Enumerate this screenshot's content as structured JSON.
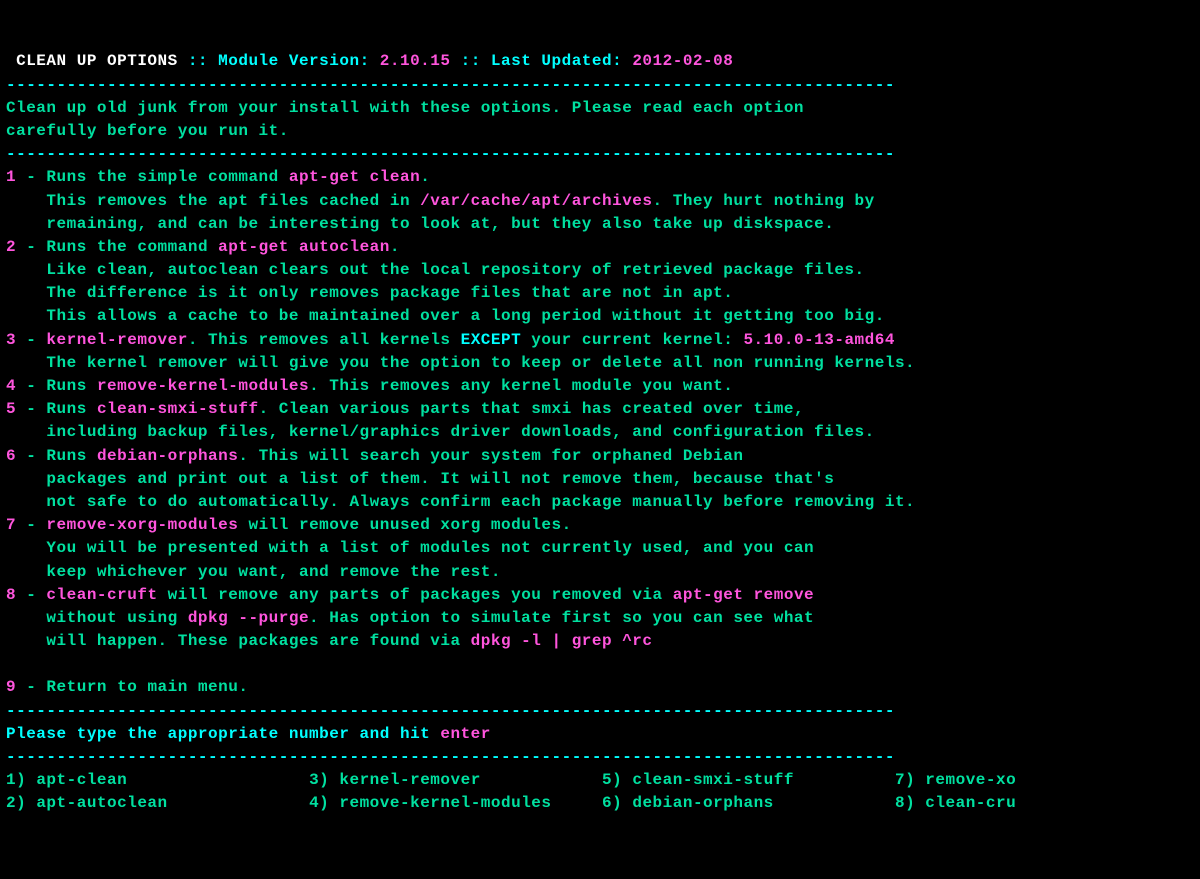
{
  "header": {
    "title": " CLEAN UP OPTIONS ",
    "sep": ":: ",
    "modlabel": "Module Version: ",
    "modver": "2.10.15",
    "sep2": " :: ",
    "updlabel": "Last Updated: ",
    "upddate": "2012-02-08"
  },
  "divider": "----------------------------------------------------------------------------------------",
  "intro1": "Clean up old junk from your install with these options. Please read each option",
  "intro2": "carefully before you run it.",
  "opt1": {
    "num": "1",
    "dash": " - ",
    "a": "Runs the simple command ",
    "cmd": "apt-get clean",
    "b": ".",
    "l2a": "    This removes the apt files cached in ",
    "l2cmd": "/var/cache/apt/archives",
    "l2b": ". They hurt nothing by",
    "l3": "    remaining, and can be interesting to look at, but they also take up diskspace."
  },
  "opt2": {
    "num": "2",
    "dash": " - ",
    "a": "Runs the command ",
    "cmd": "apt-get autoclean",
    "b": ".",
    "l2": "    Like clean, autoclean clears out the local repository of retrieved package files.",
    "l3": "    The difference is it only removes package files that are not in apt.",
    "l4": "    This allows a cache to be maintained over a long period without it getting too big."
  },
  "opt3": {
    "num": "3",
    "dash": " - ",
    "cmd": "kernel-remover",
    "a": ". This removes all kernels ",
    "exc": "EXCEPT",
    "b": " your current kernel: ",
    "kv": "5.10.0-13-amd64",
    "l2": "    The kernel remover will give you the option to keep or delete all non running kernels."
  },
  "opt4": {
    "num": "4",
    "dash": " - ",
    "a": "Runs ",
    "cmd": "remove-kernel-modules",
    "b": ". This removes any kernel module you want."
  },
  "opt5": {
    "num": "5",
    "dash": " - ",
    "a": "Runs ",
    "cmd": "clean-smxi-stuff",
    "b": ". Clean various parts that smxi has created over time,",
    "l2": "    including backup files, kernel/graphics driver downloads, and configuration files."
  },
  "opt6": {
    "num": "6",
    "dash": " - ",
    "a": "Runs ",
    "cmd": "debian-orphans",
    "b": ". This will search your system for orphaned Debian",
    "l2": "    packages and print out a list of them. It will not remove them, because that's",
    "l3": "    not safe to do automatically. Always confirm each package manually before removing it."
  },
  "opt7": {
    "num": "7",
    "dash": " - ",
    "cmd": "remove-xorg-modules",
    "a": " will remove unused xorg modules.",
    "l2": "    You will be presented with a list of modules not currently used, and you can",
    "l3": "    keep whichever you want, and remove the rest."
  },
  "opt8": {
    "num": "8",
    "dash": " - ",
    "cmd": "clean-cruft",
    "a": " will remove any parts of packages you removed via ",
    "cmd2": "apt-get remove",
    "l2a": "    without using ",
    "l2cmd": "dpkg --purge",
    "l2b": ". Has option to simulate first so you can see what",
    "l3a": "    will happen. These packages are found via ",
    "l3cmd": "dpkg -l | grep ^rc"
  },
  "opt9": {
    "num": "9",
    "dash": " - ",
    "a": "Return to main menu."
  },
  "prompt": {
    "a": "Please type the appropriate number and hit ",
    "enter": "enter"
  },
  "menu": {
    "r1_1n": "1) ",
    "r1_1t": "apt-clean",
    "r1_3n": "3) ",
    "r1_3t": "kernel-remover",
    "r1_5n": "5) ",
    "r1_5t": "clean-smxi-stuff",
    "r1_7n": "7) ",
    "r1_7t": "remove-xo",
    "r2_2n": "2) ",
    "r2_2t": "apt-autoclean",
    "r2_4n": "4) ",
    "r2_4t": "remove-kernel-modules",
    "r2_6n": "6) ",
    "r2_6t": "debian-orphans",
    "r2_8n": "8) ",
    "r2_8t": "clean-cru"
  }
}
